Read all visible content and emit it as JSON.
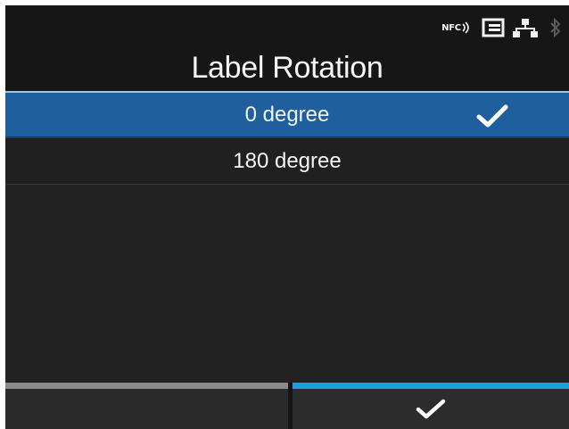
{
  "status_bar": {
    "nfc_label": "NFC",
    "icons": [
      "nfc-icon",
      "sdcard-icon",
      "network-icon",
      "bluetooth-icon"
    ]
  },
  "header": {
    "title": "Label Rotation"
  },
  "options": [
    {
      "label": "0 degree",
      "selected": true,
      "icon": "checkmark-icon"
    },
    {
      "label": "180 degree",
      "selected": false
    }
  ],
  "softkeys": {
    "left": {
      "label": ""
    },
    "right": {
      "icon": "checkmark-icon"
    }
  },
  "colors": {
    "selected_row": "#1f5f9d",
    "accent_bar": "#1aa0e0",
    "left_bar": "#8a8a8a",
    "background": "#1e1e1e"
  }
}
